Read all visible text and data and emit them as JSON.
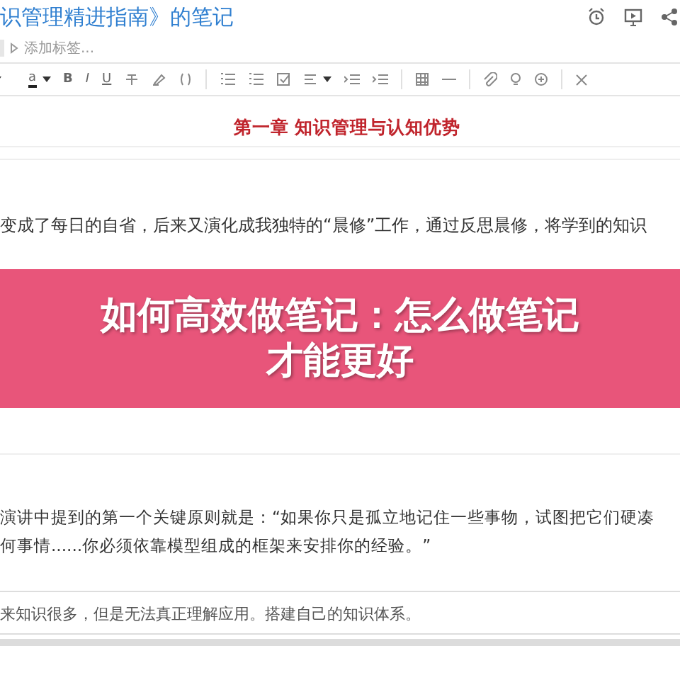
{
  "note": {
    "title": "识管理精进指南》的笔记",
    "tag_placeholder": "添加标签..."
  },
  "toolbar": [
    {
      "kind": "caret"
    },
    {
      "kind": "color",
      "label": "a"
    },
    {
      "kind": "caret"
    },
    {
      "kind": "bold",
      "label": "B"
    },
    {
      "kind": "italic",
      "label": "I"
    },
    {
      "kind": "underline",
      "label": "U"
    },
    {
      "kind": "strike"
    },
    {
      "kind": "highlight"
    },
    {
      "kind": "code"
    },
    {
      "kind": "sep"
    },
    {
      "kind": "bullets"
    },
    {
      "kind": "numbers"
    },
    {
      "kind": "checkbox"
    },
    {
      "kind": "align"
    },
    {
      "kind": "caret"
    },
    {
      "kind": "outdent"
    },
    {
      "kind": "indent"
    },
    {
      "kind": "sep"
    },
    {
      "kind": "table"
    },
    {
      "kind": "rule"
    },
    {
      "kind": "sep"
    },
    {
      "kind": "attach"
    },
    {
      "kind": "bulb"
    },
    {
      "kind": "plus"
    },
    {
      "kind": "sep"
    },
    {
      "kind": "expand"
    }
  ],
  "heading": "第一章 知识管理与认知优势",
  "paragraph_1": "变成了每日的自省，后来又演化成我独特的“晨修”工作，通过反思晨修，将学到的知识",
  "banner": {
    "lines": [
      "如何高效做笔记：怎么做笔记",
      "才能更好"
    ]
  },
  "paragraph_2": [
    "演讲中提到的第一个关键原则就是：“如果你只是孤立地记住一些事物，试图把它们硬凑",
    "何事情......你必须依靠模型组成的框架来安排你的经验。”"
  ],
  "note_line": "来知识很多，但是无法真正理解应用。搭建自己的知识体系。"
}
